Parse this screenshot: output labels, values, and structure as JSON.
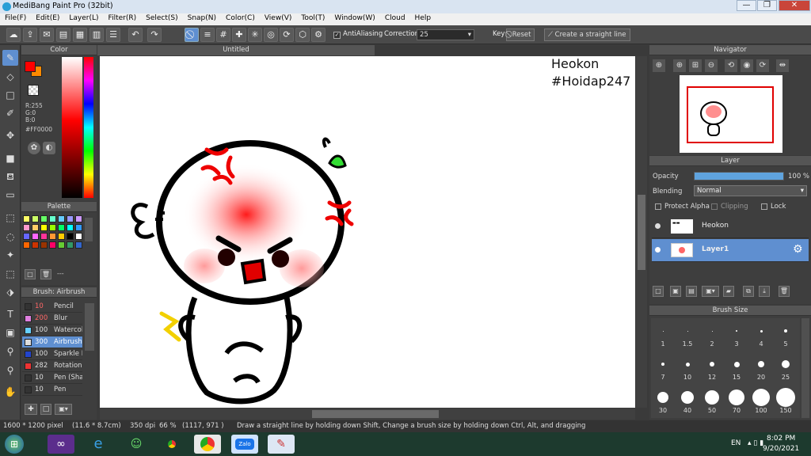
{
  "window": {
    "title": "MediBang Paint Pro (32bit)",
    "min": "—",
    "max": "❐",
    "close": "✕"
  },
  "menu": [
    "File(F)",
    "Edit(E)",
    "Layer(L)",
    "Filter(R)",
    "Select(S)",
    "Snap(N)",
    "Color(C)",
    "View(V)",
    "Tool(T)",
    "Window(W)",
    "Cloud",
    "Help"
  ],
  "toolbar": {
    "antialiasing": "AntiAliasing",
    "correction_label": "Correction",
    "correction_value": "25",
    "key_label": "Key",
    "reset_label": "Reset",
    "straight_line_label": "Create a straight line"
  },
  "color_panel": {
    "title": "Color",
    "r": "R:255",
    "g": "G:0",
    "b": "B:0",
    "hex": "#FF0000",
    "primary": "#ff0000",
    "secondary": "#ff8a00"
  },
  "palette_panel": {
    "title": "Palette",
    "colors": [
      "#ffff66",
      "#ccff66",
      "#66ff66",
      "#66ffcc",
      "#66ccff",
      "#9999ff",
      "#cc99ff",
      "#ff99cc",
      "#ffcc66",
      "#ffff00",
      "#99ff00",
      "#00ff66",
      "#00ffff",
      "#3399ff",
      "#6666ff",
      "#ff66ff",
      "#ff3399",
      "#ff9933",
      "#ffcc00",
      "#000000",
      "#ffffff",
      "#ff6600",
      "#cc3300",
      "#993300",
      "#ff0066",
      "#66cc33",
      "#339966",
      "#3366cc",
      "#996633",
      "#ccccaa"
    ],
    "footer": "---"
  },
  "brush_panel": {
    "title": "Brush: Airbrush",
    "items": [
      {
        "size": "10",
        "name": "Pencil",
        "color": "#333333"
      },
      {
        "size": "200",
        "name": "Blur",
        "color": "#e080e0"
      },
      {
        "size": "100",
        "name": "Watercolor",
        "color": "#66d0ff"
      },
      {
        "size": "300",
        "name": "Airbrush",
        "color": "#dddddd"
      },
      {
        "size": "100",
        "name": "Sparkle B",
        "color": "#2244cc"
      },
      {
        "size": "282",
        "name": "Rotation",
        "color": "#ee3333"
      },
      {
        "size": "10",
        "name": "Pen (Sha",
        "color": "#333333"
      },
      {
        "size": "10",
        "name": "Pen",
        "color": "#333333"
      }
    ]
  },
  "document": {
    "tab": "Untitled",
    "text_line1": "Heokon",
    "text_line2": "#Hoidap247"
  },
  "navigator": {
    "title": "Navigator"
  },
  "layer_panel": {
    "title": "Layer",
    "opacity_label": "Opacity",
    "opacity_value": "100 %",
    "opacity_fraction": 1.0,
    "blending_label": "Blending",
    "blending_value": "Normal",
    "protect_alpha": "Protect Alpha",
    "clipping": "Clipping",
    "lock": "Lock",
    "layers": [
      {
        "name": "Heokon",
        "selected": false
      },
      {
        "name": "Layer1",
        "selected": true
      }
    ]
  },
  "brush_size_panel": {
    "title": "Brush Size",
    "sizes": [
      "1",
      "1.5",
      "2",
      "3",
      "4",
      "5",
      "7",
      "10",
      "12",
      "15",
      "20",
      "25",
      "30",
      "40",
      "50",
      "70",
      "100",
      "150"
    ]
  },
  "status": {
    "dimensions": "1600 * 1200 pixel",
    "physical": "(11.6 * 8.7cm)",
    "dpi": "350 dpi",
    "zoom": "66 %",
    "coords": "(1117, 971 )",
    "hint": "Draw a straight line by holding down Shift, Change a brush size by holding down Ctrl, Alt, and dragging"
  },
  "taskbar": {
    "lang": "EN",
    "time": "8:02 PM",
    "date": "9/20/2021",
    "zalo": "Zalo"
  }
}
